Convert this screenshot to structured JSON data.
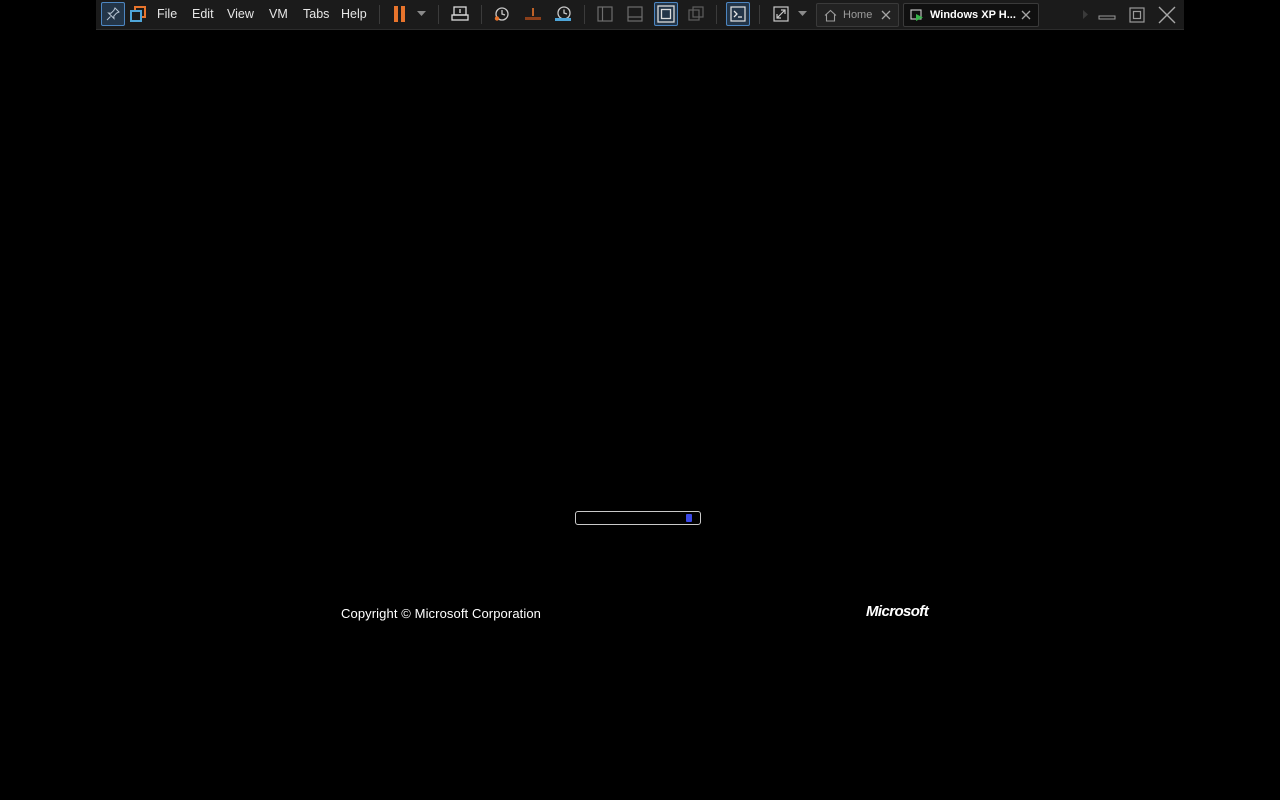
{
  "menu": {
    "file": "File",
    "edit": "Edit",
    "view": "View",
    "vm": "VM",
    "tabs": "Tabs",
    "help": "Help"
  },
  "tabs": {
    "home": "Home",
    "vm": "Windows XP H..."
  },
  "boot_screen": {
    "progress_fraction": 0.95,
    "copyright": "Copyright © Microsoft Corporation",
    "logo_text": "Microsoft"
  },
  "colors": {
    "accent_orange": "#e8742c",
    "accent_blue": "#4ea5d8",
    "progress_block": "#3a48e6"
  },
  "icons": {
    "pin": "pin-icon",
    "library": "library-icon",
    "pause": "pause-icon",
    "send_keys": "send-keys-icon",
    "snapshot": "snapshot-icon",
    "revert": "revert-snapshot-icon",
    "snapshot_manager": "snapshot-manager-icon",
    "console": "console-icon",
    "fullscreen": "fullscreen-icon"
  }
}
